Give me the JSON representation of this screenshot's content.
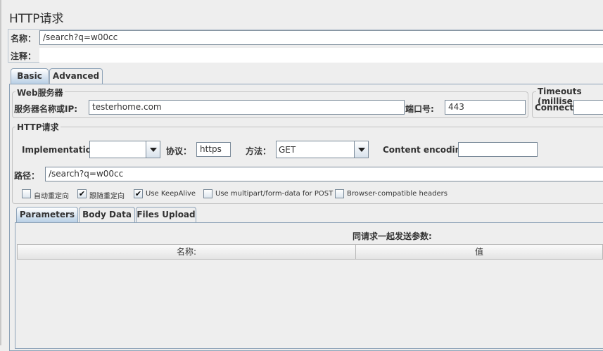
{
  "window": {
    "title": "HTTP请求"
  },
  "name_row": {
    "label": "名称：",
    "value": "/search?q=w00cc"
  },
  "comment_row": {
    "label": "注释：",
    "value": ""
  },
  "main_tabs": [
    {
      "label": "Basic",
      "active": true
    },
    {
      "label": "Advanced",
      "active": false
    }
  ],
  "web_server": {
    "legend": "Web服务器",
    "host_label": "服务器名称或IP:",
    "host_value": "testerhome.com",
    "port_label": "端口号:",
    "port_value": "443"
  },
  "timeouts": {
    "legend": "Timeouts (millise",
    "connect_label": "Connect:",
    "connect_value": ""
  },
  "http_request": {
    "legend": "HTTP请求",
    "implementation_label": "Implementation:",
    "implementation_value": "",
    "protocol_label": "协议：",
    "protocol_value": "https",
    "method_label": "方法：",
    "method_value": "GET",
    "encoding_label": "Content encoding:",
    "encoding_value": "",
    "path_label": "路径：",
    "path_value": "/search?q=w00cc"
  },
  "checkboxes": [
    {
      "label": "自动重定向",
      "checked": false
    },
    {
      "label": "跟随重定向",
      "checked": true
    },
    {
      "label": "Use KeepAlive",
      "checked": true
    },
    {
      "label": "Use multipart/form-data for POST",
      "checked": false
    },
    {
      "label": "Browser-compatible headers",
      "checked": false
    }
  ],
  "param_tabs": [
    {
      "label": "Parameters",
      "active": true
    },
    {
      "label": "Body Data",
      "active": false
    },
    {
      "label": "Files Upload",
      "active": false
    }
  ],
  "params_table": {
    "caption": "同请求一起发送参数:",
    "columns": [
      "名称:",
      "值"
    ]
  },
  "colors": {
    "background": "#eeeeee",
    "tab_active": "#b8cfe5",
    "border": "#8ea3b8"
  }
}
